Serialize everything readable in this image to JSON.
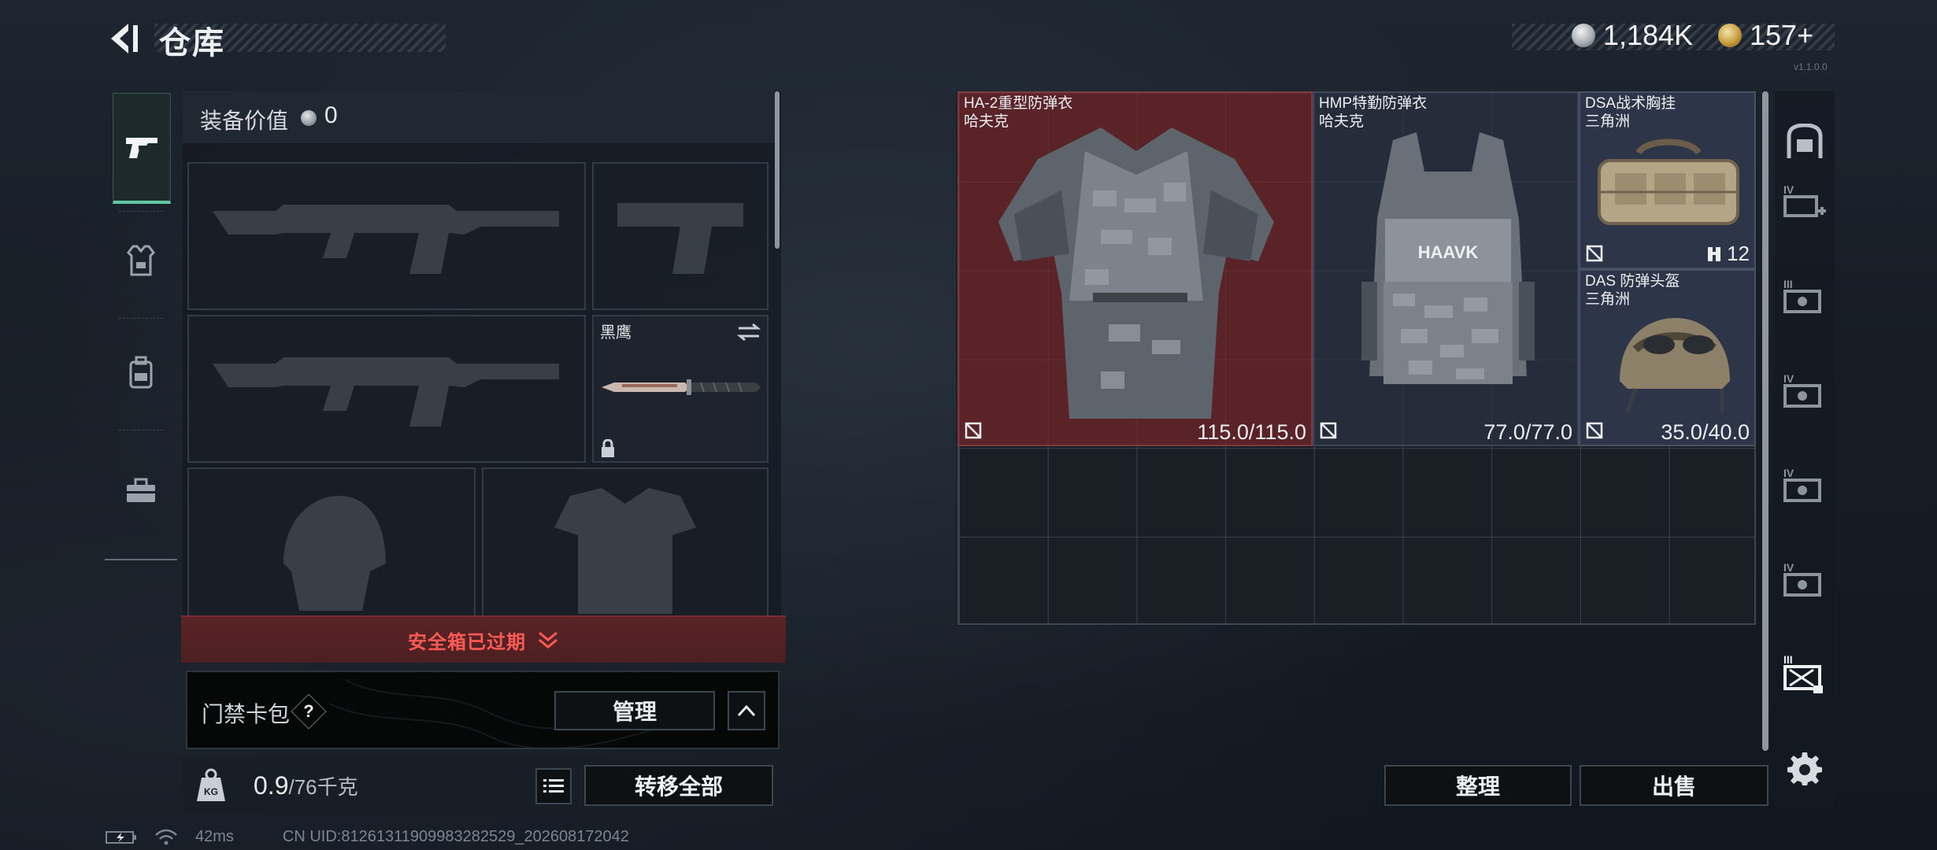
{
  "header": {
    "title": "仓库",
    "currency": [
      {
        "icon": "silver-coin-icon",
        "value": "1,184K",
        "color": "#c9ced3"
      },
      {
        "icon": "gold-coin-icon",
        "value": "157+",
        "color": "#d6b45a"
      }
    ],
    "version": "v1.1.0.0"
  },
  "left_tabs": [
    {
      "name": "pistol-icon",
      "active": true
    },
    {
      "name": "vest-icon",
      "active": false
    },
    {
      "name": "backpack-icon",
      "active": false
    },
    {
      "name": "toolbox-icon",
      "active": false
    }
  ],
  "equipment": {
    "label": "装备价值",
    "value": "0",
    "knife_slot": {
      "name": "黑鹰"
    }
  },
  "safebox": {
    "text": "安全箱已过期"
  },
  "card_pack": {
    "label": "门禁卡包",
    "help": "?",
    "manage_label": "管理"
  },
  "weight": {
    "current": "0.9",
    "max": "/76千克",
    "icon_text": "KG"
  },
  "transfer_label": "转移全部",
  "status": {
    "latency": "42ms",
    "uid": "CN UID:8126131190998328252​9_20260817204​2"
  },
  "storage": {
    "items": [
      {
        "name": "HA-2重型防弹衣",
        "brand": "哈夫克",
        "durability": "115.0/115.0",
        "rarity_color": "#6e2a30"
      },
      {
        "name": "HMP特勤防弹衣",
        "brand": "哈夫克",
        "durability": "77.0/77.0",
        "rarity_color": "#2c3648"
      },
      {
        "name": "DSA战术胸挂",
        "brand": "三角洲",
        "capacity": "12",
        "rarity_color": "#2c3648"
      },
      {
        "name": "DAS 防弹头盔",
        "brand": "三角洲",
        "durability": "35.0/40.0",
        "rarity_color": "#2c3648"
      }
    ]
  },
  "sort_label": "整理",
  "sell_label": "出售",
  "right_rail": [
    {
      "name": "storage-home-icon"
    },
    {
      "name": "storage-add-iv-icon",
      "label": "IV"
    },
    {
      "name": "storage-iii-icon",
      "label": "III"
    },
    {
      "name": "storage-iv-icon-1",
      "label": "IV"
    },
    {
      "name": "storage-iv-icon-2",
      "label": "IV"
    },
    {
      "name": "storage-iv-icon-3",
      "label": "IV"
    },
    {
      "name": "storage-iii-active-icon",
      "label": "III"
    },
    {
      "name": "settings-gear-icon"
    }
  ]
}
